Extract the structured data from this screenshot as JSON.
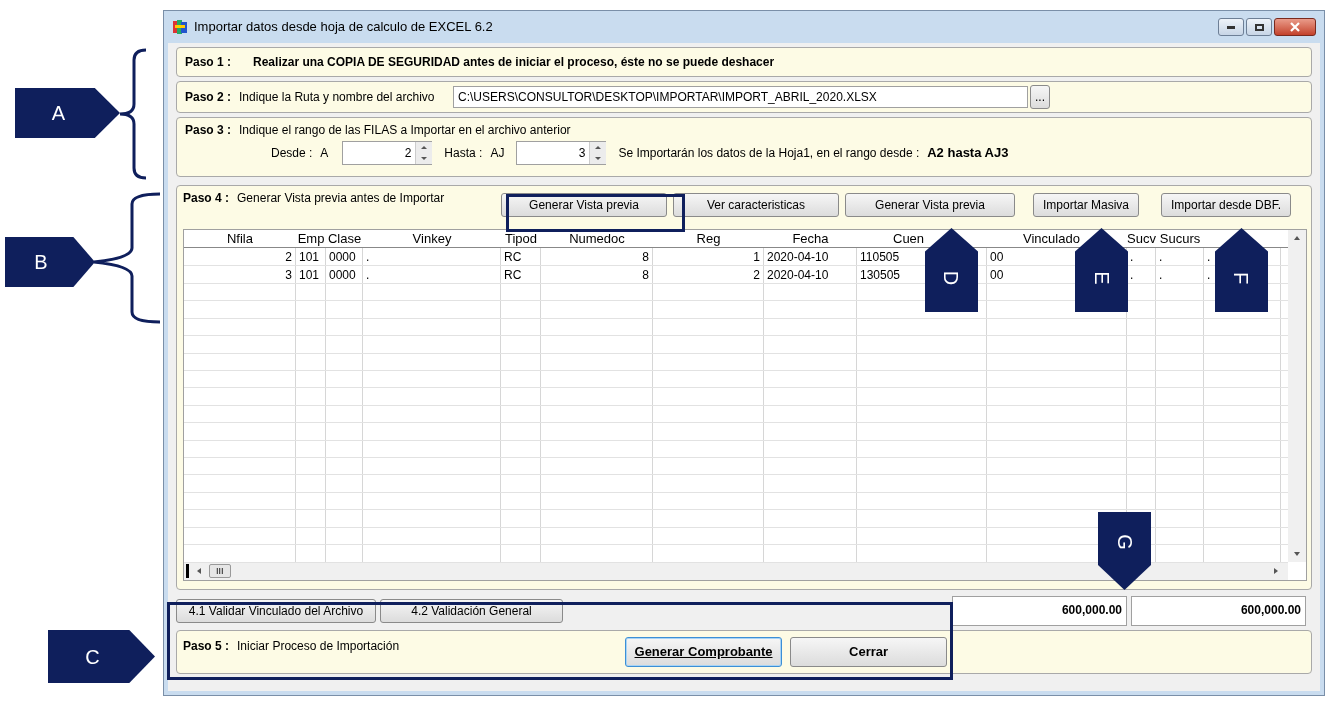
{
  "window": {
    "title": "Importar datos desde hoja de calculo de EXCEL 6.2"
  },
  "step1": {
    "label": "Paso 1 :",
    "text": "Realizar una COPIA DE SEGURIDAD antes de iniciar el proceso, éste no se puede deshacer"
  },
  "step2": {
    "label": "Paso 2 :",
    "text": "Indique la Ruta y nombre del archivo",
    "path": "C:\\USERS\\CONSULTOR\\DESKTOP\\IMPORTAR\\IMPORT_ABRIL_2020.XLSX",
    "browse": "..."
  },
  "step3": {
    "label": "Paso 3 :",
    "text": "Indique el rango de las FILAS a Importar en el archivo anterior",
    "from_label": "Desde  :",
    "from_col": "A",
    "from_value": "2",
    "to_label": "Hasta  :",
    "to_col": "AJ",
    "to_value": "3",
    "summary": "Se Importarán los datos de la Hoja1,  en el rango desde :",
    "range": "A2 hasta AJ3"
  },
  "step4": {
    "label": "Paso 4 :",
    "text": "Generar Vista previa antes de Importar",
    "buttons": [
      "Generar Vista previa",
      "Ver caracteristicas",
      "Generar Vista previa",
      "Importar Masiva",
      "Importar desde DBF."
    ]
  },
  "table": {
    "columns": [
      "Nfila",
      "Emp",
      "Clase",
      "Vinkey",
      "Tipod",
      "Numedoc",
      "Reg",
      "Fecha",
      "Cuen",
      "Vinculado",
      "Sucv",
      "Sucurs"
    ],
    "rows": [
      [
        "2",
        "101",
        "0000",
        ".",
        "RC",
        "8",
        "1",
        "2020-04-10",
        "110505",
        "00",
        ".",
        ".",
        "."
      ],
      [
        "3",
        "101",
        "0000",
        ".",
        "RC",
        "8",
        "2",
        "2020-04-10",
        "130505",
        "00",
        ".",
        ".",
        "."
      ]
    ],
    "scroll_grip": "III"
  },
  "validation_buttons": [
    "4.1 Validar Vinculado  del  Archivo",
    "4.2  Validación General"
  ],
  "totals": [
    "600,000.00",
    "600,000.00"
  ],
  "step5": {
    "label": "Paso 5 :",
    "text": "Iniciar Proceso de Importación",
    "buttons": [
      {
        "label": "Generar Comprobante",
        "focused": true
      },
      {
        "label": "Cerrar",
        "focused": false
      }
    ]
  },
  "callouts": [
    {
      "letter": "A",
      "kind": "right"
    },
    {
      "letter": "B",
      "kind": "right"
    },
    {
      "letter": "C",
      "kind": "right"
    },
    {
      "letter": "D",
      "kind": "up"
    },
    {
      "letter": "E",
      "kind": "up"
    },
    {
      "letter": "F",
      "kind": "up"
    },
    {
      "letter": "G",
      "kind": "down"
    }
  ]
}
